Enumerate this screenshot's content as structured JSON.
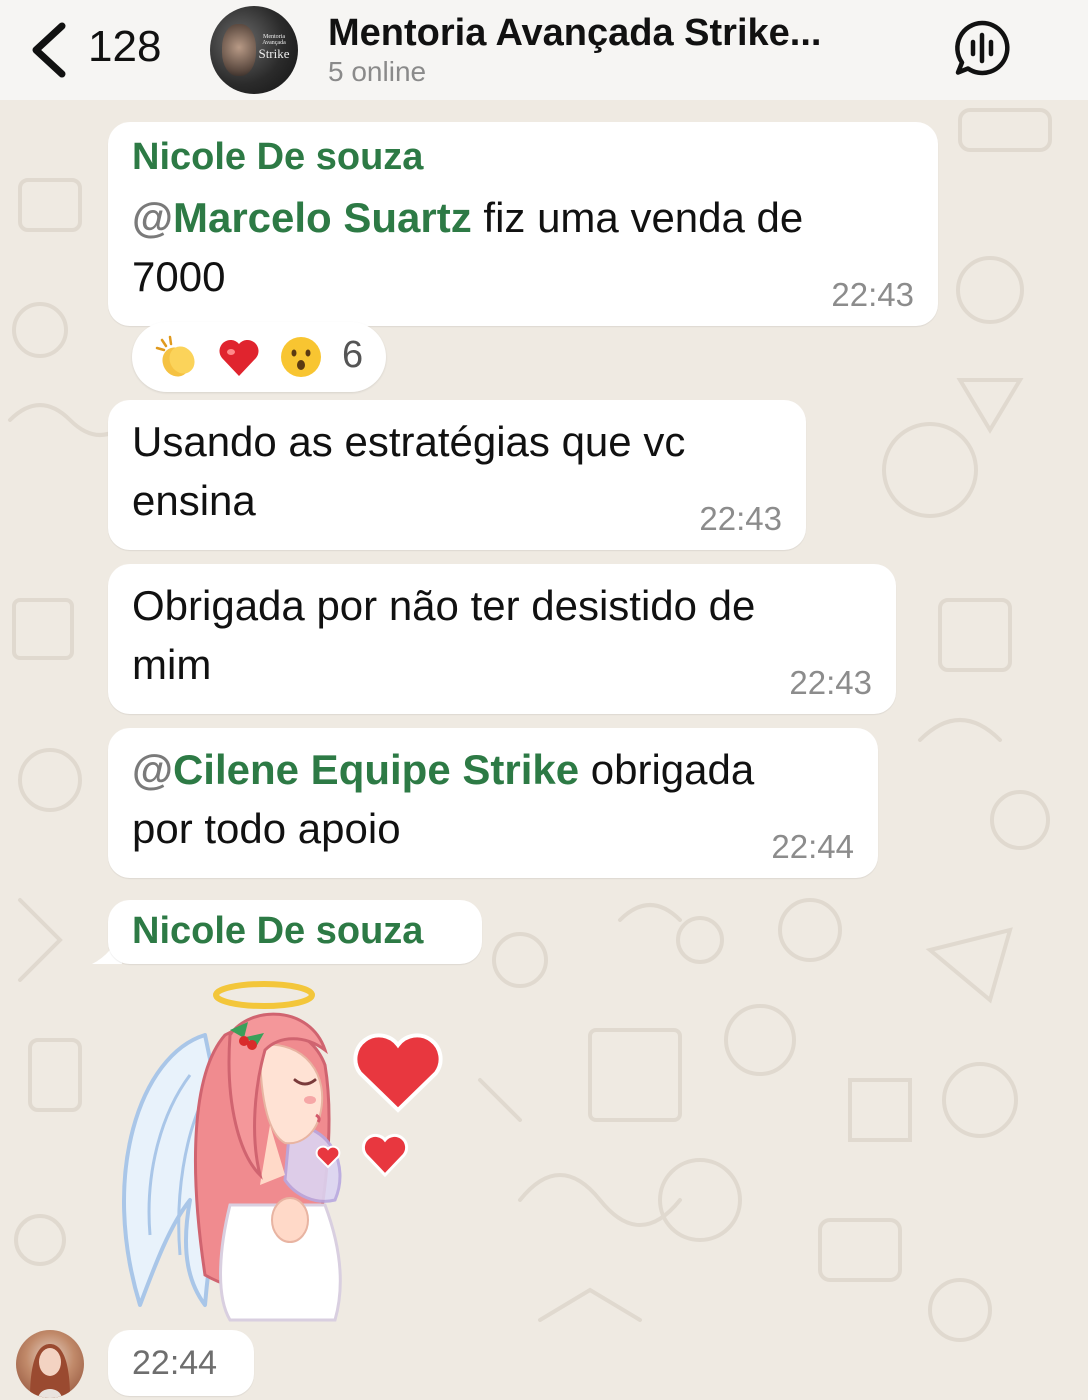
{
  "header": {
    "back_count": "128",
    "group_name": "Mentoria Avançada Strike...",
    "status": "5 online",
    "avatar_brand_small": "Mentoria Avançada",
    "avatar_brand_big": "Strike"
  },
  "messages": [
    {
      "sender": "Nicole De souza",
      "mention": "Marcelo Suartz",
      "text_after_mention": " fiz uma venda de",
      "text_line2": "7000",
      "time": "22:43",
      "reactions": {
        "emojis": [
          "clapping-hands",
          "red-heart",
          "astonished-face"
        ],
        "count": "6"
      }
    },
    {
      "line1": "Usando as estratégias que vc",
      "line2": "ensina",
      "time": "22:43"
    },
    {
      "line1": "Obrigada por não ter desistido de",
      "line2": "mim",
      "time": "22:43"
    },
    {
      "mention": "Cilene Equipe Strike",
      "text_after_mention": " obrigada",
      "line2": "por todo apoio",
      "time": "22:44"
    },
    {
      "sender": "Nicole De souza",
      "sticker": "angel-girl-hearts-sticker",
      "time": "22:44"
    }
  ],
  "colors": {
    "sender_green": "#2d7a45",
    "background": "#efeae2",
    "bubble": "#ffffff"
  }
}
